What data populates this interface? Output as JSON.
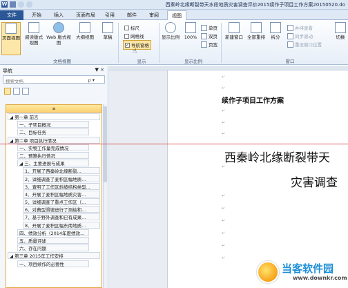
{
  "window_title": "西秦岭北缘断裂带天水段地质灾害调查评价2015续作子项目工作方案20150520.do",
  "tabs": [
    "文件",
    "开始",
    "插入",
    "页面布局",
    "引用",
    "邮件",
    "审阅",
    "视图"
  ],
  "ribbon": {
    "doc_views": {
      "items": [
        "页面视图",
        "阅读版式视图",
        "Web 版式视图",
        "大纲视图",
        "草稿"
      ],
      "group_label": "文档视图"
    },
    "show": {
      "ruler": "标尺",
      "gridlines": "网格线",
      "nav_pane": "导航窗格",
      "group_label": "显示"
    },
    "zoom": {
      "zoom_btn": "显示比例",
      "hundred": "100%",
      "one_page": "单页",
      "two_page": "双页",
      "page_width": "页宽",
      "group_label": "显示比例"
    },
    "window": {
      "new_window": "新建窗口",
      "arrange_all": "全部重排",
      "split": "拆分",
      "side_by_side": "并排查看",
      "sync_scroll": "同步滚动",
      "reset_position": "重设窗口位置",
      "switch": "切换",
      "group_label": "窗口"
    }
  },
  "nav": {
    "title": "导航",
    "pin": "▼ ×",
    "search_placeholder": "搜索文档",
    "search_icon": "ρ ▾",
    "collapse_symbol": "≡",
    "tree": [
      {
        "label": "第一章 前言",
        "level": 0
      },
      {
        "label": "一、子项目概况",
        "level": 1
      },
      {
        "label": "二、目标任务",
        "level": 1
      },
      {
        "label": "第二章 项目执行情况",
        "level": 0
      },
      {
        "label": "一、实物工作量完成情况",
        "level": 1
      },
      {
        "label": "二、预算执行情况",
        "level": 1
      },
      {
        "label": "三、主要进展与成果",
        "level": 1
      },
      {
        "label": "1．开展了西秦岭北缘断裂...",
        "level": 2
      },
      {
        "label": "2．详细调查了麦积区幅地质...",
        "level": 2
      },
      {
        "label": "3．查明了工作区斜坡结构类型...",
        "level": 2
      },
      {
        "label": "4．开展了麦积区幅地质灾害...",
        "level": 2
      },
      {
        "label": "5．详细调查了重点工作区（...",
        "level": 2
      },
      {
        "label": "6．对典型滑坡进行了测绘和...",
        "level": 2
      },
      {
        "label": "7．基于野外调查和已有成果...",
        "level": 2
      },
      {
        "label": "8．开展了麦积区幅东南地质...",
        "level": 2
      },
      {
        "label": "四、绩效分析（2014年度绩效...",
        "level": 1
      },
      {
        "label": "五、质量评述",
        "level": 1
      },
      {
        "label": "六、存在问题",
        "level": 1
      },
      {
        "label": "第三章 2015年工作安排",
        "level": 0
      },
      {
        "label": "一、项目续作的必要性",
        "level": 1
      }
    ]
  },
  "doc": {
    "title_line": "续作子项目工作方案",
    "para_mark": "↵",
    "big_line1": "西秦岭北缘断裂带天",
    "big_line2": "灾害调查"
  },
  "watermark": {
    "brand": "当客软件园",
    "url": "www.downkr.com"
  },
  "colors": {
    "file_tab": "#2b5797",
    "selection": "#fde7a8",
    "red_line": "#e05555",
    "brand": "#1d8fd8"
  }
}
